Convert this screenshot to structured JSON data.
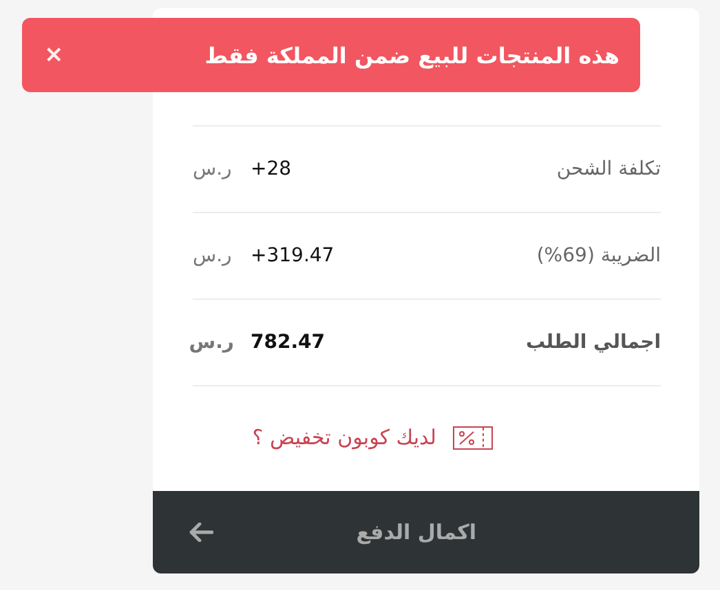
{
  "toast": {
    "message": "هذه المنتجات للبيع ضمن المملكة فقط",
    "close": "×"
  },
  "summary": [
    {
      "label": "تكلفة الشحن",
      "value": "+28",
      "currency": "ر.س",
      "total": false
    },
    {
      "label": "الضريبة (69%)",
      "value": "+319.47",
      "currency": "ر.س",
      "total": false
    },
    {
      "label": "اجمالي الطلب",
      "value": "782.47",
      "currency": "ر.س",
      "total": true
    }
  ],
  "coupon": {
    "label": "لديك كوبون تخفيض ؟"
  },
  "checkout": {
    "label": "اكمال الدفع"
  }
}
